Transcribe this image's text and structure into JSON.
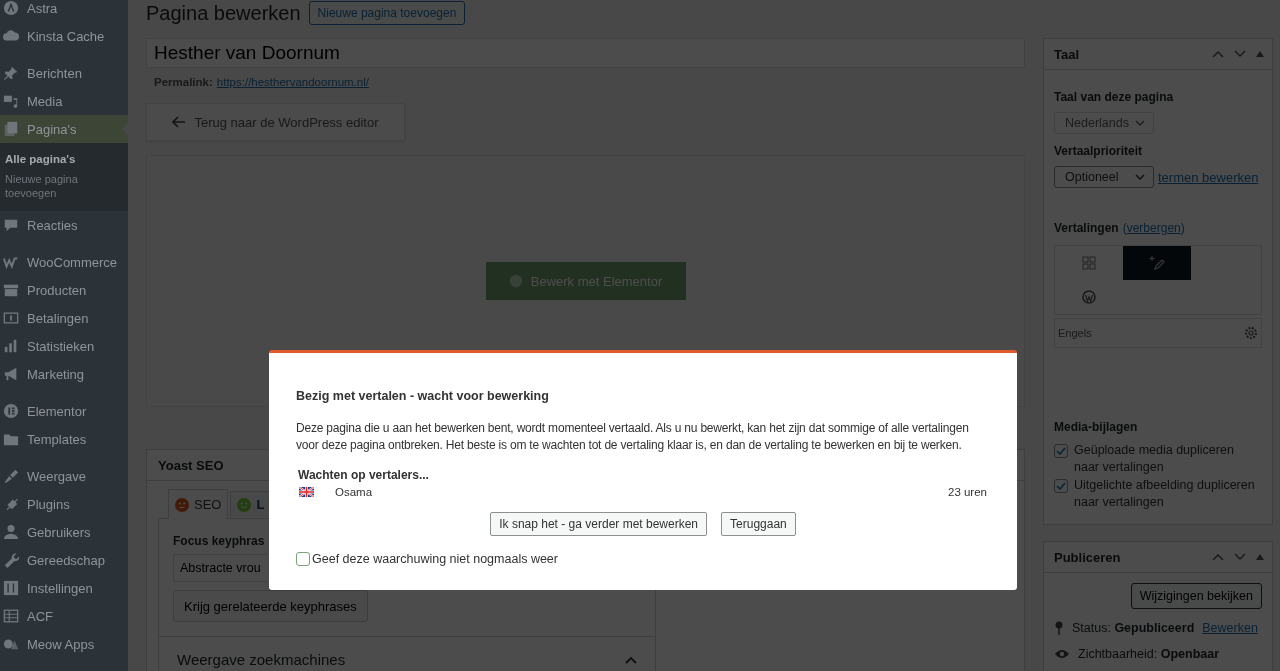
{
  "sidebar": {
    "groups": [
      {
        "items": [
          {
            "label": "Astra",
            "selected": false
          },
          {
            "label": "Kinsta Cache",
            "selected": false
          }
        ]
      },
      {
        "items": [
          {
            "label": "Berichten",
            "selected": false
          },
          {
            "label": "Media",
            "selected": false
          },
          {
            "label": "Pagina's",
            "selected": true,
            "submenu": [
              {
                "label": "Alle pagina's",
                "selected": true
              },
              {
                "label": "Nieuwe pagina toevoegen",
                "selected": false
              }
            ]
          },
          {
            "label": "Reacties",
            "selected": false
          }
        ]
      },
      {
        "items": [
          {
            "label": "WooCommerce",
            "selected": false
          },
          {
            "label": "Producten",
            "selected": false
          },
          {
            "label": "Betalingen",
            "selected": false
          },
          {
            "label": "Statistieken",
            "selected": false
          },
          {
            "label": "Marketing",
            "selected": false
          }
        ]
      },
      {
        "items": [
          {
            "label": "Elementor",
            "selected": false
          },
          {
            "label": "Templates",
            "selected": false
          }
        ]
      },
      {
        "items": [
          {
            "label": "Weergave",
            "selected": false
          },
          {
            "label": "Plugins",
            "selected": false
          },
          {
            "label": "Gebruikers",
            "selected": false
          },
          {
            "label": "Gereedschap",
            "selected": false
          },
          {
            "label": "Instellingen",
            "selected": false
          },
          {
            "label": "ACF",
            "selected": false
          },
          {
            "label": "Meow Apps",
            "selected": false
          }
        ]
      }
    ]
  },
  "page": {
    "heading": "Pagina bewerken",
    "add_button": "Nieuwe pagina toevoegen",
    "title_value": "Hesther van Doornum",
    "permalink_label": "Permalink:",
    "permalink_url": "https://hesthervandoornum.nl/",
    "back_button": "Terug naar de WordPress editor",
    "elementor_button": "Bewerk met Elementor"
  },
  "yoast": {
    "title": "Yoast SEO",
    "tabs": [
      {
        "label": "SEO",
        "good": false,
        "selected": true
      },
      {
        "label": "L",
        "good": true,
        "selected": false
      }
    ],
    "focus_label": "Focus keyphras",
    "focus_value": "Abstracte vrou",
    "related_button": "Krijg gerelateerde keyphrases",
    "section_title": "Weergave zoekmachines",
    "expanded": true
  },
  "language_box": {
    "title": "Taal",
    "page_language_label": "Taal van deze pagina",
    "page_language": "Nederlands",
    "page_language_disabled": true,
    "priority_label": "Vertaalprioriteit",
    "priority": "Optioneel",
    "terms_link": "termen bewerken",
    "translations_label": "Vertalingen",
    "paren_open": "(",
    "hide_link": "verbergen",
    "paren_close": ")",
    "translations": [
      {
        "language": "Engels"
      }
    ],
    "media_label": "Media-bijlagen",
    "options": [
      {
        "label": "Geüploade media dupliceren naar vertalingen",
        "checked": true
      },
      {
        "label": "Uitgelichte afbeelding dupliceren naar vertalingen",
        "checked": true
      }
    ]
  },
  "publish_box": {
    "title": "Publiceren",
    "preview_button": "Wijzigingen bekijken",
    "status": "Status: **Gepubliceerd**",
    "status_link": "Bewerken",
    "visibility": "Zichtbaarheid: **Openbaar**"
  },
  "dialog": {
    "title": "Bezig met vertalen - wacht voor bewerking",
    "message": "Deze pagina die u aan het bewerken bent, wordt momenteel vertaald. Als u nu bewerkt, kan het zijn dat sommige of alle vertalingen voor deze pagina ontbreken. Het beste is om te wachten tot de vertaling klaar is, en dan de vertaling te bewerken en bij te werken.",
    "waiting_label": "Wachten op vertalers...",
    "translators": [
      {
        "name": "Osama",
        "time": "23 uren"
      }
    ],
    "buttons": [
      "Ik snap het - ga verder met bewerken",
      "Teruggaan"
    ],
    "dont_show": {
      "label": "Geef deze waarchuwing niet nogmaals weer",
      "checked": false
    }
  }
}
